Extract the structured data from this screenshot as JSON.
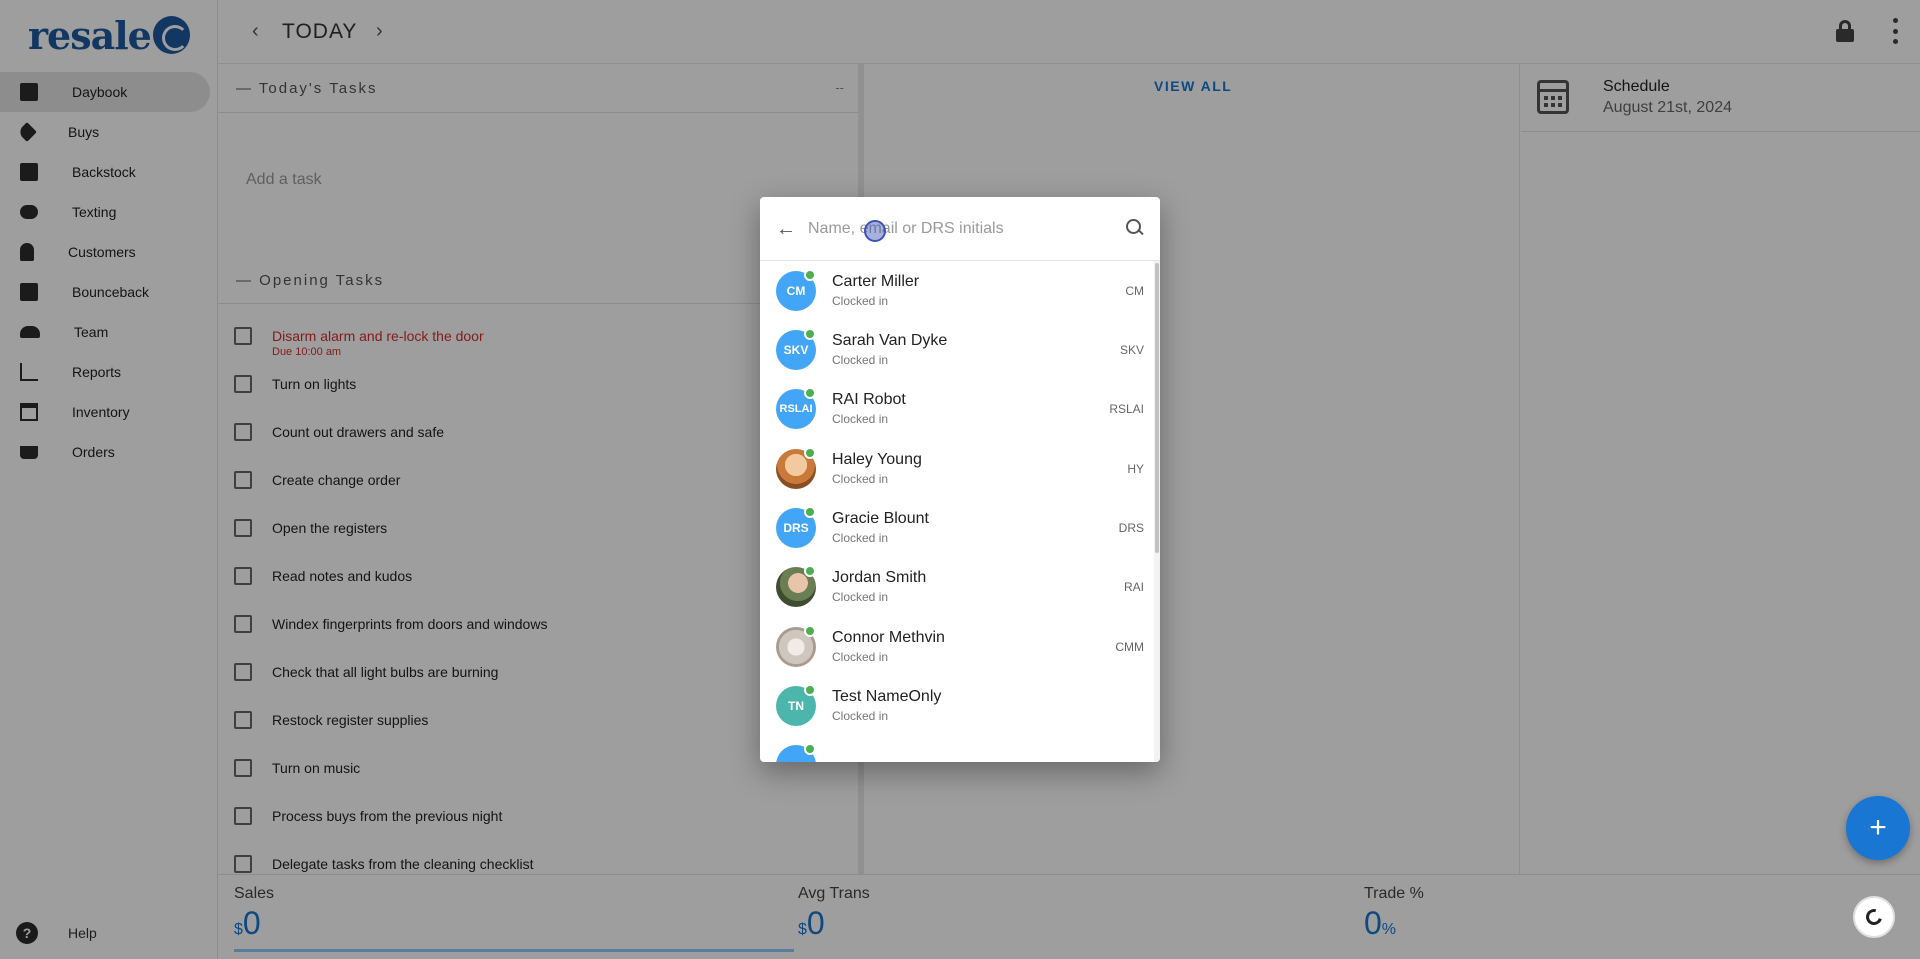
{
  "sidebar": {
    "logo": "resale",
    "items": [
      {
        "label": "Daybook",
        "icon": "book-icon",
        "active": true
      },
      {
        "label": "Buys",
        "icon": "tags-icon"
      },
      {
        "label": "Backstock",
        "icon": "archive-icon"
      },
      {
        "label": "Texting",
        "icon": "chat-icon"
      },
      {
        "label": "Customers",
        "icon": "person-icon"
      },
      {
        "label": "Bounceback",
        "icon": "gift-icon"
      },
      {
        "label": "Team",
        "icon": "group-icon"
      },
      {
        "label": "Reports",
        "icon": "chart-icon"
      },
      {
        "label": "Inventory",
        "icon": "warehouse-icon"
      },
      {
        "label": "Orders",
        "icon": "cart-icon"
      }
    ],
    "help": "Help"
  },
  "header": {
    "title": "TODAY",
    "prev": "‹",
    "next": "›"
  },
  "tasks": {
    "todays_heading": "Today's Tasks",
    "todays_count": "--",
    "add_placeholder": "Add a task",
    "opening_heading": "Opening Tasks",
    "items": [
      {
        "text": "Disarm alarm and re-lock the door",
        "due": "Due 10:00 am",
        "overdue": true
      },
      {
        "text": "Turn on lights"
      },
      {
        "text": "Count out drawers and safe"
      },
      {
        "text": "Create change order"
      },
      {
        "text": "Open the registers"
      },
      {
        "text": "Read notes and kudos"
      },
      {
        "text": "Windex fingerprints from doors and windows"
      },
      {
        "text": "Check that all light bulbs are burning"
      },
      {
        "text": "Restock register supplies"
      },
      {
        "text": "Turn on music"
      },
      {
        "text": "Process buys from the previous night"
      },
      {
        "text": "Delegate tasks from the cleaning checklist"
      }
    ]
  },
  "middle": {
    "view_all": "VIEW ALL"
  },
  "schedule": {
    "title": "Schedule",
    "date": "August 21st, 2024"
  },
  "stats": {
    "sales": {
      "label": "Sales",
      "symbol": "$",
      "value": "0"
    },
    "avg_trans": {
      "label": "Avg Trans",
      "symbol": "$",
      "value": "0"
    },
    "trade": {
      "label": "Trade %",
      "value": "0",
      "suffix": "%"
    }
  },
  "fab": {
    "label": "+"
  },
  "dialog": {
    "search_placeholder": "Name, email or DRS initials",
    "search_value": "",
    "people": [
      {
        "name": "Carter Miller",
        "status": "Clocked in",
        "code": "CM",
        "initials": "CM",
        "avatar": "initials"
      },
      {
        "name": "Sarah Van Dyke",
        "status": "Clocked in",
        "code": "SKV",
        "initials": "SKV",
        "avatar": "initials"
      },
      {
        "name": "RAI Robot",
        "status": "Clocked in",
        "code": "RSLAI",
        "initials": "RSLAI",
        "avatar": "initials"
      },
      {
        "name": "Haley Young",
        "status": "Clocked in",
        "code": "HY",
        "initials": "",
        "avatar": "photo"
      },
      {
        "name": "Gracie Blount",
        "status": "Clocked in",
        "code": "DRS",
        "initials": "DRS",
        "avatar": "initials"
      },
      {
        "name": "Jordan Smith",
        "status": "Clocked in",
        "code": "RAI",
        "initials": "",
        "avatar": "photo"
      },
      {
        "name": "Connor Methvin",
        "status": "Clocked in",
        "code": "CMM",
        "initials": "",
        "avatar": "photo"
      },
      {
        "name": "Test NameOnly",
        "status": "Clocked in",
        "code": "",
        "initials": "TN",
        "avatar": "initials"
      }
    ]
  },
  "colors": {
    "accent": "#1976d2",
    "brand": "#1e5a9e",
    "online": "#4caf50",
    "overdue": "#d32f2f"
  }
}
